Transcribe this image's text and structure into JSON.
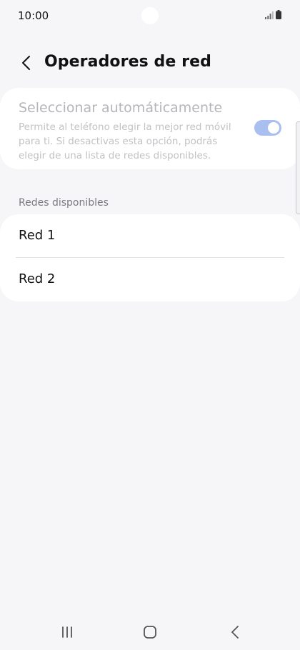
{
  "status_bar": {
    "time": "10:00"
  },
  "header": {
    "title": "Operadores de red",
    "back_icon": "chevron-left-icon"
  },
  "auto_select": {
    "title": "Seleccionar automáticamente",
    "description": "Permite al teléfono elegir la mejor red móvil para ti. Si desactivas esta opción, podrás elegir de una lista de redes disponibles.",
    "toggle_on": true,
    "disabled": true
  },
  "available_networks": {
    "section_label": "Redes disponibles",
    "items": [
      {
        "label": "Red 1"
      },
      {
        "label": "Red 2"
      }
    ]
  },
  "nav_bar": {
    "icons": [
      "recent-apps-icon",
      "home-icon",
      "back-icon"
    ]
  },
  "colors": {
    "background": "#f6f6f8",
    "card": "#ffffff",
    "toggle_track_disabled": "#a9bff0",
    "disabled_text": "#b5b5ba"
  }
}
